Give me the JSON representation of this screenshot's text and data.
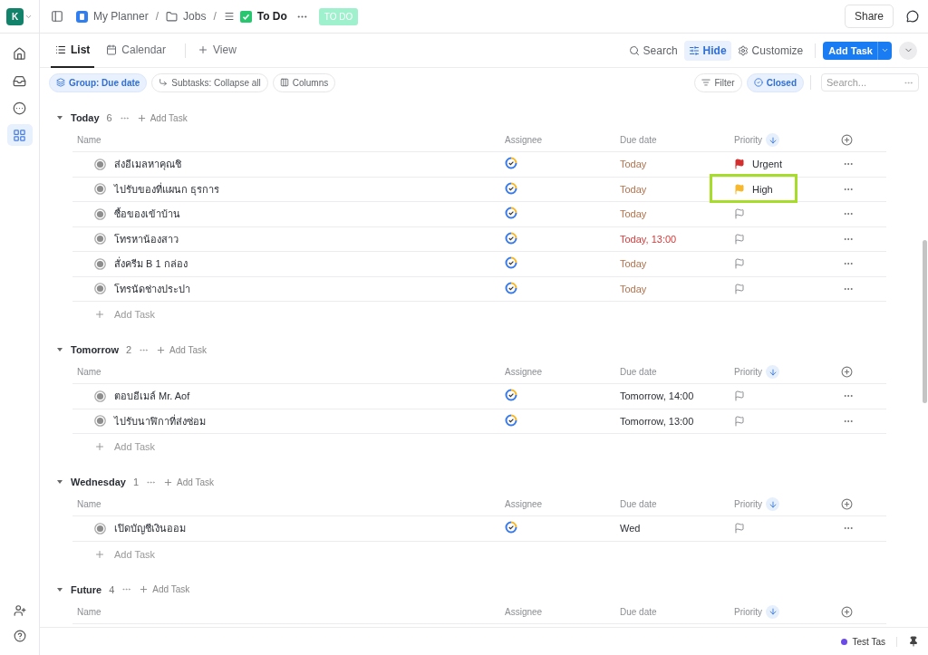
{
  "workspace": {
    "initial": "K"
  },
  "breadcrumb": [
    {
      "label": "My Planner",
      "kind": "planner"
    },
    {
      "label": "Jobs",
      "kind": "folder"
    },
    {
      "label": "To Do",
      "kind": "list"
    }
  ],
  "breadcrumb_separators": [
    "/",
    "/"
  ],
  "status_badge": "TO DO",
  "share_button": "Share",
  "sidebar": {
    "items": [
      {
        "kind": "home",
        "selected": false
      },
      {
        "kind": "inbox",
        "selected": false
      },
      {
        "kind": "more",
        "selected": false
      },
      {
        "kind": "spaces",
        "selected": true
      }
    ],
    "bottom_items": [
      {
        "kind": "invite"
      },
      {
        "kind": "help"
      }
    ]
  },
  "views": [
    {
      "label": "List",
      "kind": "list",
      "selected": true
    },
    {
      "label": "Calendar",
      "kind": "calendar",
      "selected": false
    }
  ],
  "add_view": "View",
  "toolbar": [
    {
      "label": "Search",
      "kind": "search",
      "selected": false
    },
    {
      "label": "Hide",
      "kind": "hide",
      "selected": true
    },
    {
      "label": "Customize",
      "kind": "customize",
      "selected": false
    }
  ],
  "add_task_button": "Add Task",
  "filters_left": [
    {
      "label": "Group: Due date",
      "kind": "group",
      "selected": true
    },
    {
      "label": "Subtasks: Collapse all",
      "kind": "subtasks",
      "selected": false
    },
    {
      "label": "Columns",
      "kind": "columns",
      "selected": false
    }
  ],
  "filters_right": [
    {
      "label": "Filter",
      "kind": "filter",
      "selected": false
    },
    {
      "label": "Closed",
      "kind": "closed",
      "selected": true
    }
  ],
  "search": {
    "placeholder": "Search..."
  },
  "groups": [
    {
      "title": "Today",
      "count": "6",
      "expanded": true,
      "add_task": "Add Task",
      "columns": [
        "Name",
        "Assignee",
        "Due date",
        "Priority"
      ],
      "footer_add": "Add Task",
      "tasks": [
        {
          "name": "ส่งอีเมลหาคุณชิ",
          "due": "Today",
          "due_soon": true,
          "overdue": false,
          "priority": {
            "kind": "urgent",
            "label": "Urgent",
            "highlighted": false
          }
        },
        {
          "name": "ไปรับของที่แผนก ธุรการ",
          "due": "Today",
          "due_soon": true,
          "overdue": false,
          "priority": {
            "kind": "high",
            "label": "High",
            "highlighted": true
          }
        },
        {
          "name": "ซื้อของเข้าบ้าน",
          "due": "Today",
          "due_soon": true,
          "overdue": false,
          "priority": {
            "kind": "none",
            "highlighted": false
          }
        },
        {
          "name": "โทรหาน้องสาว",
          "due": "Today, 13:00",
          "due_soon": true,
          "overdue": true,
          "priority": {
            "kind": "none",
            "highlighted": false
          }
        },
        {
          "name": "สั่งครีม B 1 กล่อง",
          "due": "Today",
          "due_soon": true,
          "overdue": false,
          "priority": {
            "kind": "none",
            "highlighted": false
          }
        },
        {
          "name": "โทรนัดช่างประปา",
          "due": "Today",
          "due_soon": true,
          "overdue": false,
          "priority": {
            "kind": "none",
            "highlighted": false
          }
        }
      ]
    },
    {
      "title": "Tomorrow",
      "count": "2",
      "expanded": true,
      "add_task": "Add Task",
      "columns": [
        "Name",
        "Assignee",
        "Due date",
        "Priority"
      ],
      "footer_add": "Add Task",
      "tasks": [
        {
          "name": "ตอบอีเมล์ Mr. Aof",
          "due": "Tomorrow, 14:00",
          "due_soon": false,
          "overdue": false,
          "priority": {
            "kind": "none",
            "highlighted": false
          }
        },
        {
          "name": "ไปรับนาฬิกาที่ส่งซ่อม",
          "due": "Tomorrow, 13:00",
          "due_soon": false,
          "overdue": false,
          "priority": {
            "kind": "none",
            "highlighted": false
          }
        }
      ]
    },
    {
      "title": "Wednesday",
      "count": "1",
      "expanded": true,
      "add_task": "Add Task",
      "columns": [
        "Name",
        "Assignee",
        "Due date",
        "Priority"
      ],
      "footer_add": "Add Task",
      "tasks": [
        {
          "name": "เปิดบัญชีเงินออม",
          "due": "Wed",
          "due_soon": false,
          "overdue": false,
          "priority": {
            "kind": "none",
            "highlighted": false
          }
        }
      ]
    },
    {
      "title": "Future",
      "count": "4",
      "expanded": true,
      "add_task": "Add Task",
      "columns": [
        "Name",
        "Assignee",
        "Due date",
        "Priority"
      ]
    }
  ],
  "footer": {
    "task": "Test Tas"
  }
}
